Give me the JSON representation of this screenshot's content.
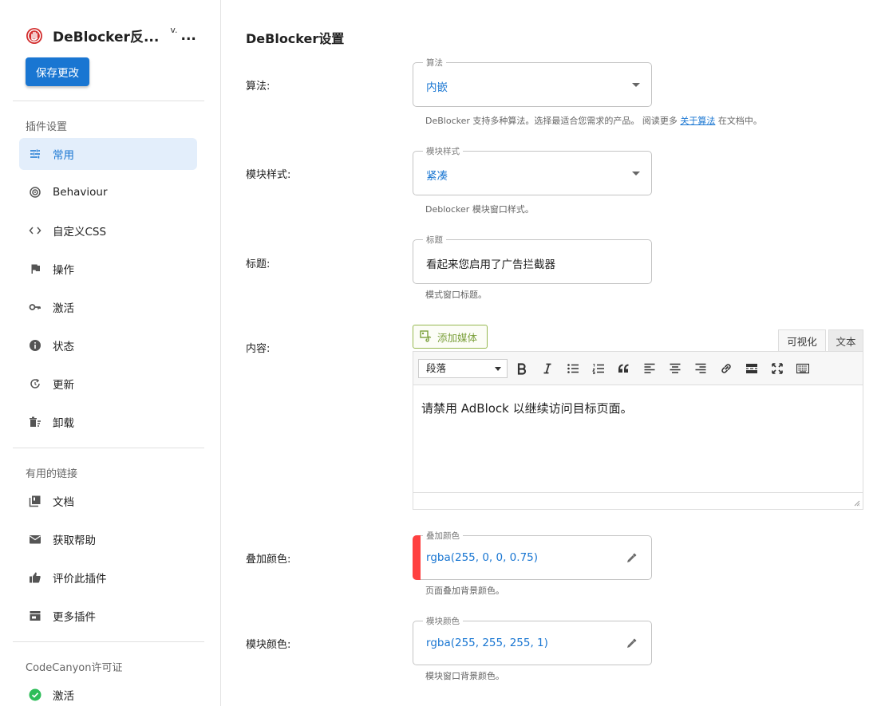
{
  "sidebar": {
    "brand_title": "DeBlocker反...",
    "version": "v.",
    "version_more": "...",
    "save_label": "保存更改",
    "sections": {
      "plugin_settings": "插件设置",
      "useful_links": "有用的链接",
      "license": "CodeCanyon许可证"
    },
    "items": [
      {
        "label": "常用",
        "icon": "sliders-icon",
        "active": true
      },
      {
        "label": "Behaviour",
        "icon": "target-icon"
      },
      {
        "label": "自定义CSS",
        "icon": "code-icon"
      },
      {
        "label": "操作",
        "icon": "flag-icon"
      },
      {
        "label": "激活",
        "icon": "key-icon"
      },
      {
        "label": "状态",
        "icon": "info-icon"
      },
      {
        "label": "更新",
        "icon": "refresh-icon"
      },
      {
        "label": "卸载",
        "icon": "trash-icon"
      }
    ],
    "links": [
      {
        "label": "文档",
        "icon": "library-icon"
      },
      {
        "label": "获取帮助",
        "icon": "mail-icon"
      },
      {
        "label": "评价此插件",
        "icon": "thumb-up-icon"
      },
      {
        "label": "更多插件",
        "icon": "store-icon"
      }
    ],
    "license_items": [
      {
        "label": "激活",
        "icon": "check-circle-icon",
        "color": "#2ebd59"
      }
    ]
  },
  "main": {
    "title": "DeBlocker设置",
    "algorithm": {
      "label": "算法:",
      "legend": "算法",
      "value": "内嵌",
      "help_prefix": "DeBlocker 支持多种算法。选择最适合您需求的产品。 阅读更多 ",
      "help_link": "关于算法",
      "help_suffix": " 在文档中。"
    },
    "modal_style": {
      "label": "模块样式:",
      "legend": "模块样式",
      "value": "紧凑",
      "help": "Deblocker 模块窗口样式。"
    },
    "heading": {
      "label": "标题:",
      "legend": "标题",
      "value": "看起来您启用了广告拦截器",
      "help": "模式窗口标题。"
    },
    "content": {
      "label": "内容:",
      "add_media": "添加媒体",
      "tab_visual": "可视化",
      "tab_text": "文本",
      "format": "段落",
      "text": "请禁用 AdBlock 以继续访问目标页面。"
    },
    "overlay_color": {
      "label": "叠加颜色:",
      "legend": "叠加颜色",
      "value": "rgba(255, 0, 0, 0.75)",
      "swatch": "#ff4040",
      "help": "页面叠加背景颜色。"
    },
    "modal_color": {
      "label": "模块颜色:",
      "legend": "模块颜色",
      "value": "rgba(255, 255, 255, 1)",
      "help": "模块窗口背景颜色。"
    }
  },
  "colors": {
    "accent": "#1976d2",
    "active_bg": "#e3eefb",
    "media_green": "#7ba03b"
  }
}
